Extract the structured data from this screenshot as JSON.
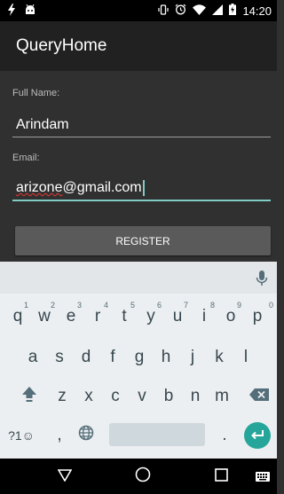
{
  "status_bar": {
    "time": "14:20",
    "left_icons": [
      "flash-icon",
      "android-debug-icon"
    ],
    "right_icons": [
      "vibrate-icon",
      "alarm-icon",
      "wifi-icon",
      "cell-signal-icon",
      "battery-charging-icon"
    ]
  },
  "app_bar": {
    "title": "QueryHome"
  },
  "form": {
    "full_name_label": "Full Name:",
    "full_name_value": "Arindam",
    "email_label": "Email:",
    "email_user": "arizone",
    "email_domain": "@gmail.com",
    "register_label": "REGISTER"
  },
  "keyboard": {
    "row1": [
      {
        "key": "q",
        "hint": "1"
      },
      {
        "key": "w",
        "hint": "2"
      },
      {
        "key": "e",
        "hint": "3"
      },
      {
        "key": "r",
        "hint": "4"
      },
      {
        "key": "t",
        "hint": "5"
      },
      {
        "key": "y",
        "hint": "6"
      },
      {
        "key": "u",
        "hint": "7"
      },
      {
        "key": "i",
        "hint": "8"
      },
      {
        "key": "o",
        "hint": "9"
      },
      {
        "key": "p",
        "hint": "0"
      }
    ],
    "row2": [
      "a",
      "s",
      "d",
      "f",
      "g",
      "h",
      "j",
      "k",
      "l"
    ],
    "row3": [
      "z",
      "x",
      "c",
      "v",
      "b",
      "n",
      "m"
    ],
    "symbols_label": "?1☺",
    "comma": ",",
    "period": ".",
    "accent_color": "#26a69a"
  },
  "colors": {
    "background": "#303030",
    "app_bar": "#212121",
    "focus_underline": "#80cbc4",
    "button": "#5a5a5a"
  }
}
